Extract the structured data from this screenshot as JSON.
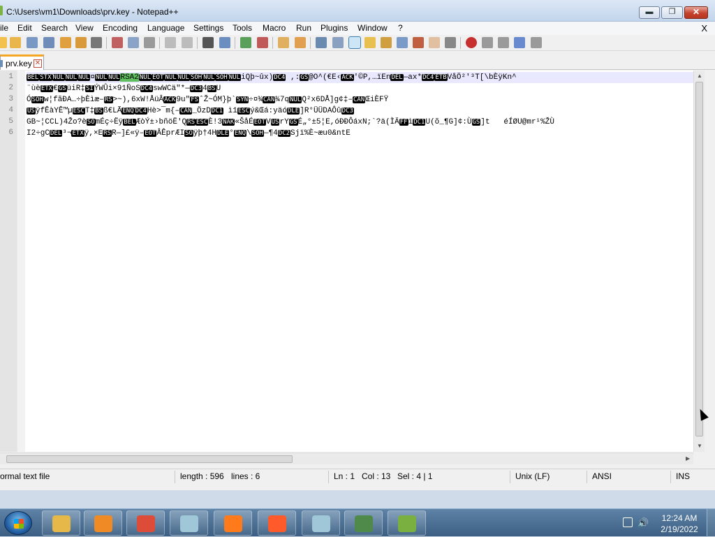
{
  "window": {
    "title": "C:\\Users\\vm1\\Downloads\\prv.key - Notepad++",
    "minimize": "▬",
    "maximize": "❐",
    "close": "✕"
  },
  "menu": {
    "items": [
      "ile",
      "Edit",
      "Search",
      "View",
      "Encoding",
      "Language",
      "Settings",
      "Tools",
      "Macro",
      "Run",
      "Plugins",
      "Window",
      "?"
    ],
    "close_doc": "X"
  },
  "tab": {
    "label": "prv.key",
    "close": "✕"
  },
  "editor": {
    "line_numbers": [
      "1",
      "2",
      "3",
      "4",
      "5",
      "6"
    ],
    "lines": [
      "BEL|STX|NUL|NUL|NUL|¤|NUL|NUL|~RSA2|NUL|EOT|NUL|NUL|SOH|NUL|SOH|NUL|iQþ~ûx)|DC4| ,:|GS|@O^(€E‹|ACK|'©P,…ïEn|DEL|—ax*|DC4|ETB|VåÖ²'³T[\\bÈÿKn^",
      "¨ùè|ETX|€|GS|üiR‡|SI|ÝWÛi×91ÑoS|DC4|swWCä\"*—|DC3|4|BS|U",
      "Ó|SOH|w¦fãÐA…÷þÈìæ–|RS|>~),6xW!ÅüÂ|ACK|9u\"|FS|ˆŽ~ÓM}þ`|SYN|÷¤¾|CAN|¾7q|NUL|Q²x6DÅ]g¢‡–|CAN|ŒiÈFŸ",
      "|US|ÿfÊàYÊ™µ|ESC|T‡|BS|ß€LÃ|ENQ|DC4|Hè>¯m{–|CAN|_ÖzD|DC1| ì1|ESC|ý&Œá:yäó|DLE|]R°ÜÜDAÔû|DC3",
      "GB~¦CCL)4Žo?è|SO|mÉç÷Ëÿ|BEL|ÆòÝ±›bñöË'Q|RS|ESC|È!3|NAK|«ŠåÉ|EOT|V|US|rY|GS|É„°±5¦E,óÐÐÔáxN;`?ä(ÌÄ|FF|ì|DC1|U(õ_¶G]¢:Ù|GS|]t   éÍØU@mr¹%ŽÙ",
      "I2÷gC|DEL|³¬|ETX|ÿ,×E|RS|R—]£«ÿ–|EOT|ÂÊprÆI|SO|ÿþ†4H|DLE|°|ENQ|\\|SOH|—¶4|DC2|Sjï%È~æu0&ntE"
    ]
  },
  "status": {
    "type": "ormal text file",
    "length": "length : 596",
    "lines": "lines : 6",
    "ln": "Ln : 1",
    "col": "Col : 13",
    "sel": "Sel : 4 | 1",
    "eol": "Unix (LF)",
    "encoding": "ANSI",
    "mode": "INS"
  },
  "taskbar": {
    "time": "12:24 AM",
    "date": "2/19/2022",
    "buttons": [
      {
        "name": "explorer-taskbar-button",
        "color": "#e6b84a"
      },
      {
        "name": "media-player-taskbar-button",
        "color": "#f08a24"
      },
      {
        "name": "chrome-taskbar-button",
        "color": "#dd4b39"
      },
      {
        "name": "notepad-taskbar-button",
        "color": "#9fc7d8"
      },
      {
        "name": "firefox-taskbar-button",
        "color": "#ff7a1a"
      },
      {
        "name": "firefox-2-taskbar-button",
        "color": "#ff5a2a"
      },
      {
        "name": "notepad-2-taskbar-button",
        "color": "#9fc7d8"
      },
      {
        "name": "textviewer-taskbar-button",
        "color": "#4f8a4a"
      },
      {
        "name": "notepadpp-taskbar-button",
        "color": "#79b03f"
      }
    ]
  },
  "colors": {
    "accent": "#f5a623",
    "control_char_bg": "#000000",
    "selection": "#60c060",
    "current_line": "#e8e8ff"
  }
}
